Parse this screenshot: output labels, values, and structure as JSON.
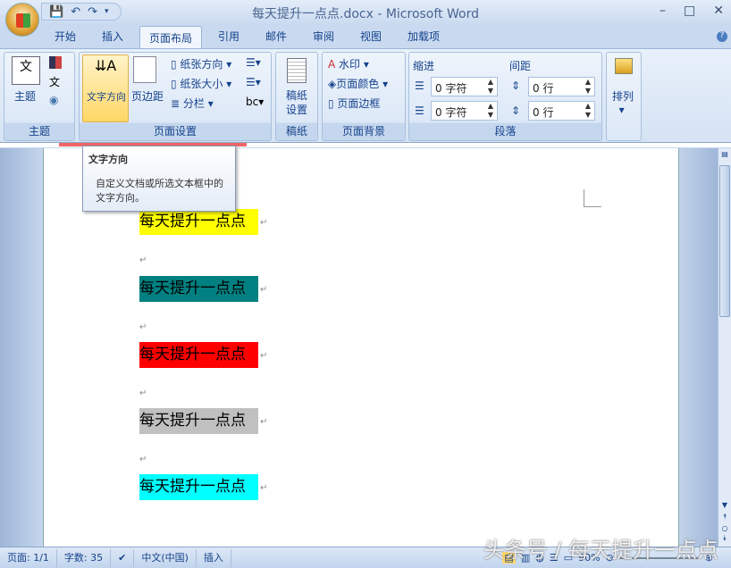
{
  "title": "每天提升一点点.docx - Microsoft Word",
  "window_controls": {
    "minimize": "–",
    "maximize": "□",
    "close": "✕"
  },
  "tabs": [
    "开始",
    "插入",
    "页面布局",
    "引用",
    "邮件",
    "审阅",
    "视图",
    "加载项"
  ],
  "active_tab": "页面布局",
  "ribbon": {
    "themes": {
      "label": "主题",
      "button": "主题"
    },
    "page_setup": {
      "label": "页面设置",
      "text_direction": "文字方向",
      "margins": "页边距",
      "orientation": "纸张方向",
      "size": "纸张大小",
      "columns": "分栏"
    },
    "manuscript": {
      "label": "稿纸",
      "button": "稿纸设置"
    },
    "page_background": {
      "label": "页面背景",
      "watermark": "水印",
      "page_color": "页面颜色",
      "page_borders": "页面边框"
    },
    "paragraph": {
      "label": "段落",
      "indent": "缩进",
      "spacing": "间距",
      "indent_left": "0 字符",
      "indent_right": "0 字符",
      "spacing_before": "0 行",
      "spacing_after": "0 行"
    },
    "arrange": {
      "button": "排列"
    }
  },
  "tooltip": {
    "title": "文字方向",
    "body": "自定义文档或所选文本框中的文字方向。"
  },
  "document": {
    "lines": [
      {
        "text": "每天提升一点点",
        "highlight": "#ffff00"
      },
      {
        "text": "每天提升一点点",
        "highlight": "#008080"
      },
      {
        "text": "每天提升一点点",
        "highlight": "#ff0000"
      },
      {
        "text": "每天提升一点点",
        "highlight": "#c0c0c0"
      },
      {
        "text": "每天提升一点点",
        "highlight": "#00ffff"
      }
    ]
  },
  "status": {
    "page": "页面: 1/1",
    "words": "字数: 35",
    "language": "中文(中国)",
    "mode": "插入",
    "zoom": "90%"
  },
  "watermark": "头条号 / 每天提升一点点"
}
